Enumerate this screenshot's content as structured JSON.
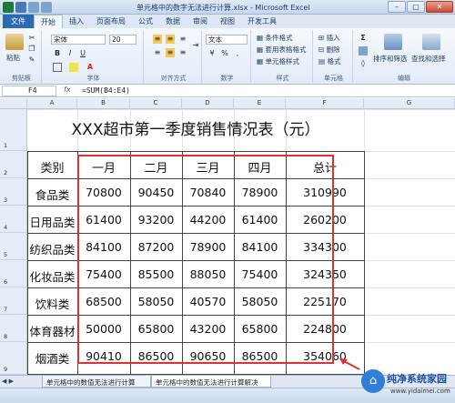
{
  "window": {
    "title": "单元格中的数字无法进行计算.xlsx - Microsoft Excel",
    "minimize_label": "–",
    "maximize_label": "□",
    "close_label": "✕"
  },
  "tabs": [
    "文件",
    "开始",
    "插入",
    "页面布局",
    "公式",
    "数据",
    "审阅",
    "视图",
    "开发工具"
  ],
  "ribbon": {
    "clipboard": {
      "paste_label": "粘贴",
      "group_label": "剪贴板"
    },
    "font": {
      "font_name": "宋体",
      "font_size": "20",
      "group_label": "字体",
      "bold": "B",
      "italic": "I",
      "underline": "U",
      "font_color_glyph": "A"
    },
    "alignment": {
      "group_label": "对齐方式"
    },
    "number": {
      "format": "文本",
      "group_label": "数字"
    },
    "styles": {
      "conditional": "条件格式",
      "table": "套用表格格式",
      "cell_styles": "单元格样式",
      "group_label": "样式"
    },
    "cells": {
      "insert": "插入",
      "delete": "删除",
      "format": "格式",
      "group_label": "单元格"
    },
    "editing": {
      "sort": "排序和筛选",
      "find": "查找和选择",
      "group_label": "编辑"
    }
  },
  "formula_bar": {
    "name_box": "F4",
    "fx": "fx",
    "formula": "=SUM(B4:E4)"
  },
  "columns": [
    "A",
    "B",
    "C",
    "D",
    "E",
    "F",
    "G"
  ],
  "rows": [
    "1",
    "2",
    "3",
    "4",
    "5",
    "6",
    "7",
    "8",
    "9"
  ],
  "sheet": {
    "title": "XXX超市第一季度销售情况表（元）",
    "headers": [
      "类别",
      "一月",
      "二月",
      "三月",
      "四月",
      "总计"
    ],
    "data": [
      [
        "食品类",
        "70800",
        "90450",
        "70840",
        "78900",
        "310990"
      ],
      [
        "日用品类",
        "61400",
        "93200",
        "44200",
        "61400",
        "260200"
      ],
      [
        "纺织品类",
        "84100",
        "87200",
        "78900",
        "84100",
        "334300"
      ],
      [
        "化妆品类",
        "75400",
        "85500",
        "88050",
        "75400",
        "324350"
      ],
      [
        "饮料类",
        "68500",
        "58050",
        "40570",
        "58050",
        "225170"
      ],
      [
        "体育器材",
        "50000",
        "65800",
        "43200",
        "65800",
        "224800"
      ],
      [
        "烟酒类",
        "90410",
        "86500",
        "90650",
        "86500",
        "354060"
      ]
    ]
  },
  "sheet_tabs": {
    "nav": "◀ ▶",
    "tab1": "单元格中的数值无法进行计算",
    "tab2": "单元格中的数值无法进行计算解决"
  },
  "watermark": {
    "name": "纯净系统家园",
    "url": "www.yidaimei.com"
  },
  "colors": {
    "highlight": "#e03030",
    "file_tab": "#2a6ab3",
    "watermark": "#1f4fa8"
  }
}
